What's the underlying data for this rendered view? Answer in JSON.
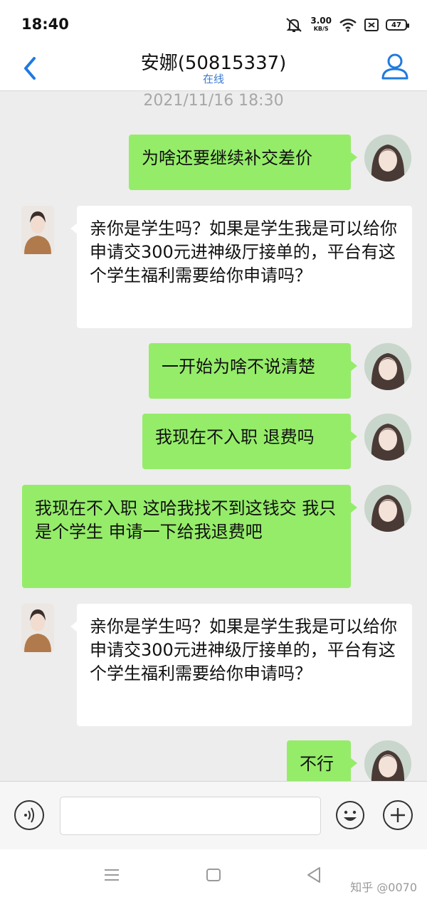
{
  "status_bar": {
    "time": "18:40",
    "net_speed": "3.00",
    "net_unit": "KB/S",
    "battery": "47",
    "icons": [
      "mute-icon",
      "wifi-icon",
      "sim-icon",
      "battery-icon"
    ]
  },
  "header": {
    "title": "安娜(50815337)",
    "status": "在线",
    "back_icon": "chevron-left-icon",
    "profile_icon": "user-icon",
    "accent": "#3a7bd5"
  },
  "chat": {
    "timestamp": "2021/11/16 18:30",
    "messages": [
      {
        "sender": "me",
        "text": "为啥还要继续补交差价"
      },
      {
        "sender": "them",
        "text": "亲你是学生吗？如果是学生我是可以给你申请交300元进神级厅接单的，平台有这个学生福利需要给你申请吗？"
      },
      {
        "sender": "me",
        "text": "一开始为啥不说清楚"
      },
      {
        "sender": "me",
        "text": "我现在不入职 退费吗"
      },
      {
        "sender": "me",
        "text": "我现在不入职  这哈我找不到这钱交 我只是个学生  申请一下给我退费吧"
      },
      {
        "sender": "them",
        "text": "亲你是学生吗？如果是学生我是可以给你申请交300元进神级厅接单的，平台有这个学生福利需要给你申请吗？"
      },
      {
        "sender": "me",
        "text": "不行"
      }
    ],
    "colors": {
      "me_bubble": "#95ec69",
      "them_bubble": "#ffffff",
      "background": "#ededed"
    }
  },
  "input_bar": {
    "voice_icon": "voice-icon",
    "emoji_icon": "emoji-icon",
    "plus_icon": "plus-icon"
  },
  "nav_bar": {
    "icons": [
      "menu-icon",
      "home-icon",
      "back-triangle-icon"
    ],
    "watermark": "知乎 @0070"
  }
}
